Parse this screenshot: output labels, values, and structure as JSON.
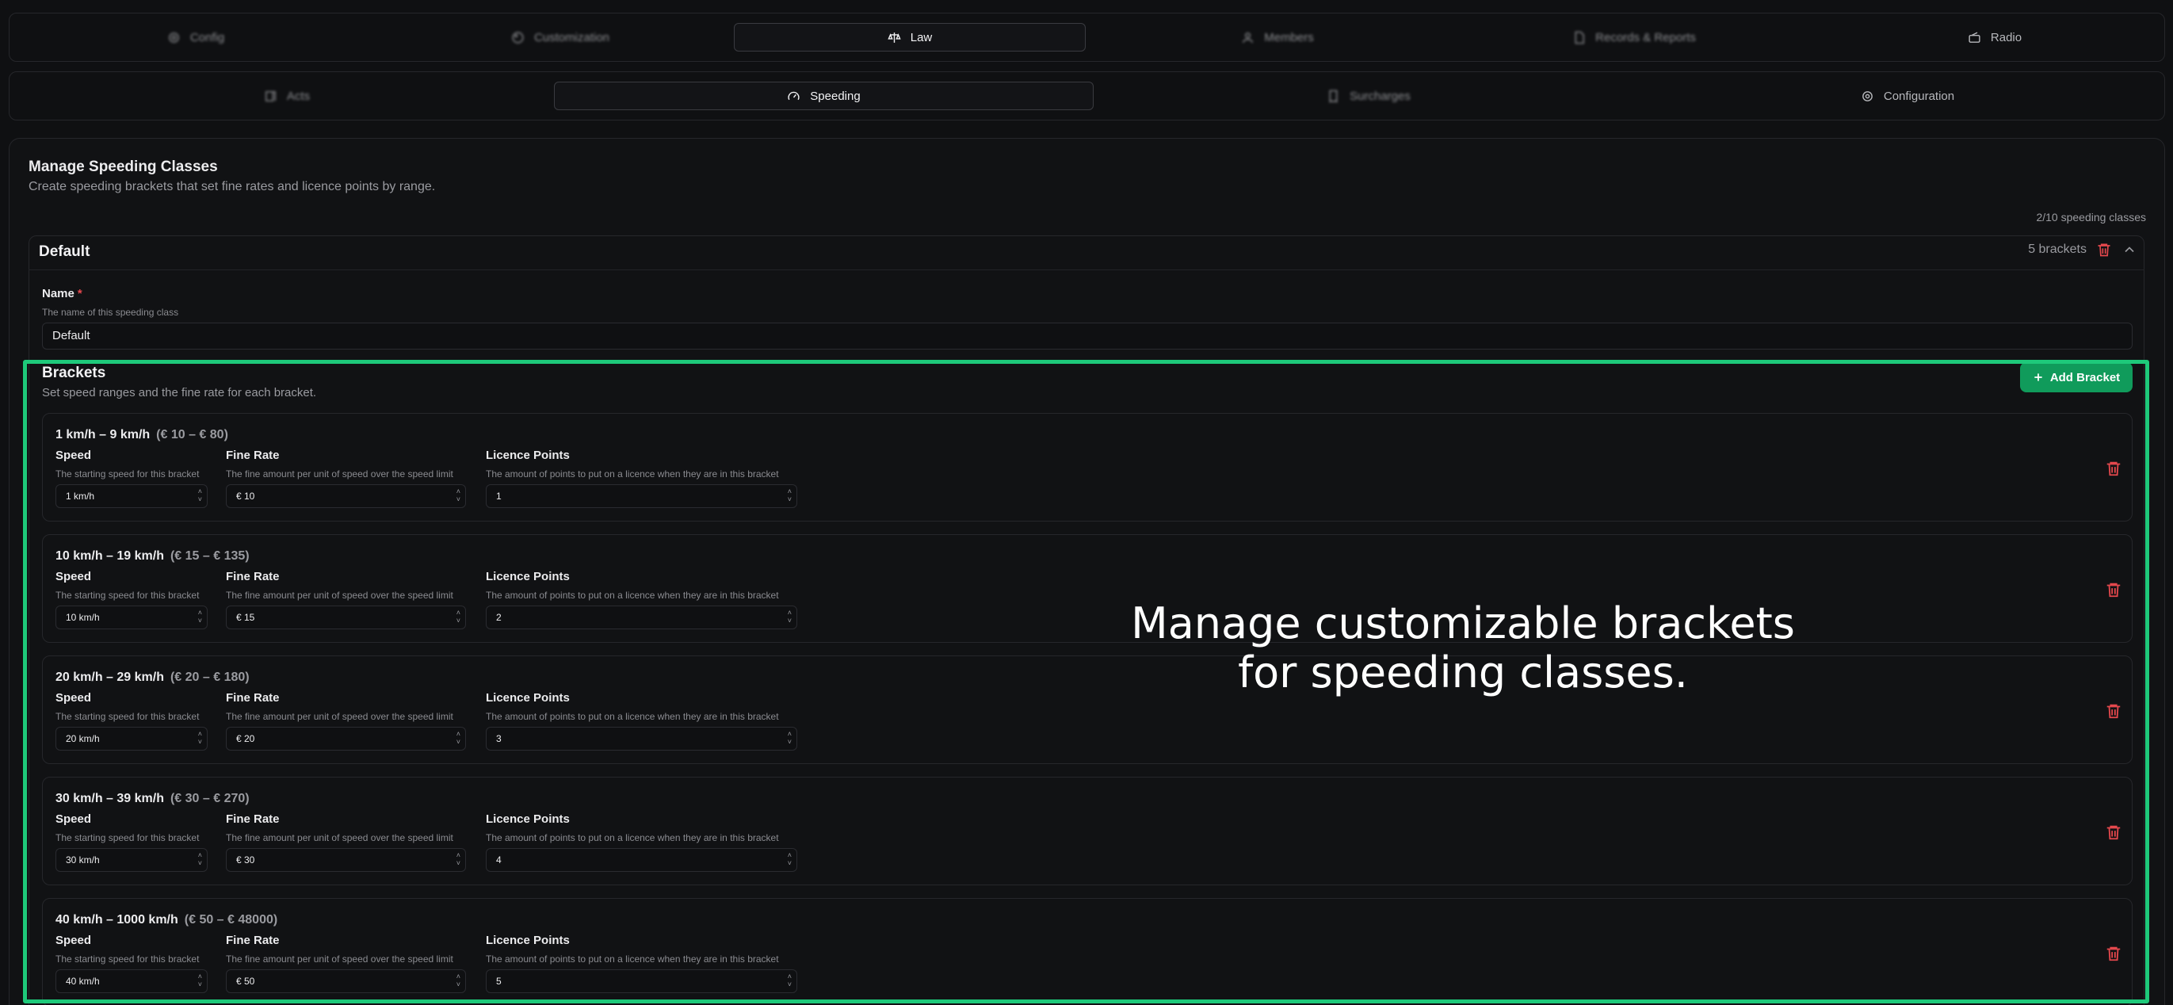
{
  "topnav": {
    "tabs": [
      {
        "label": "Config",
        "icon": "gear-icon",
        "active": false
      },
      {
        "label": "Customization",
        "icon": "palette-icon",
        "active": false
      },
      {
        "label": "Law",
        "icon": "scale-icon",
        "active": true
      },
      {
        "label": "Members",
        "icon": "user-icon",
        "active": false
      },
      {
        "label": "Records & Reports",
        "icon": "document-icon",
        "active": false
      },
      {
        "label": "Radio",
        "icon": "radio-icon",
        "active": false
      }
    ]
  },
  "subnav": {
    "tabs": [
      {
        "label": "Acts",
        "icon": "book-icon",
        "active": false
      },
      {
        "label": "Speeding",
        "icon": "gauge-icon",
        "active": true
      },
      {
        "label": "Surcharges",
        "icon": "receipt-icon",
        "active": false
      },
      {
        "label": "Configuration",
        "icon": "gear-icon",
        "active": false
      }
    ]
  },
  "page": {
    "title": "Manage Speeding Classes",
    "subtitle": "Create speeding brackets that set fine rates and licence points by range.",
    "class_count": "2/10 speeding classes"
  },
  "speeding_class": {
    "name": "Default",
    "bracket_count": "5 brackets",
    "name_field": {
      "label": "Name",
      "required_mark": "*",
      "description": "The name of this speeding class",
      "value": "Default"
    }
  },
  "brackets_section": {
    "title": "Brackets",
    "subtitle": "Set speed ranges and the fine rate for each bracket.",
    "add_button": "Add Bracket"
  },
  "bracket_fields": {
    "speed_label": "Speed",
    "speed_desc": "The starting speed for this bracket",
    "fine_label": "Fine Rate",
    "fine_desc": "The fine amount per unit of speed over the speed limit",
    "points_label": "Licence Points",
    "points_desc": "The amount of points to put on a licence when they are in this bracket"
  },
  "brackets": [
    {
      "title": "1 km/h – 9 km/h",
      "range": "(€ 10 – € 80)",
      "speed": "1 km/h",
      "fine": "€ 10",
      "points": "1"
    },
    {
      "title": "10 km/h – 19 km/h",
      "range": "(€ 15 – € 135)",
      "speed": "10 km/h",
      "fine": "€ 15",
      "points": "2"
    },
    {
      "title": "20 km/h – 29 km/h",
      "range": "(€ 20 – € 180)",
      "speed": "20 km/h",
      "fine": "€ 20",
      "points": "3"
    },
    {
      "title": "30 km/h – 39 km/h",
      "range": "(€ 30 – € 270)",
      "speed": "30 km/h",
      "fine": "€ 30",
      "points": "4"
    },
    {
      "title": "40 km/h – 1000 km/h",
      "range": "(€ 50 – € 48000)",
      "speed": "40 km/h",
      "fine": "€ 50",
      "points": "5"
    }
  ],
  "overlay": {
    "line1": "Manage customizable brackets",
    "line2": "for speeding classes."
  },
  "colors": {
    "accent": "#109b5b",
    "highlight": "#1ec97a",
    "danger": "#e5484d"
  }
}
